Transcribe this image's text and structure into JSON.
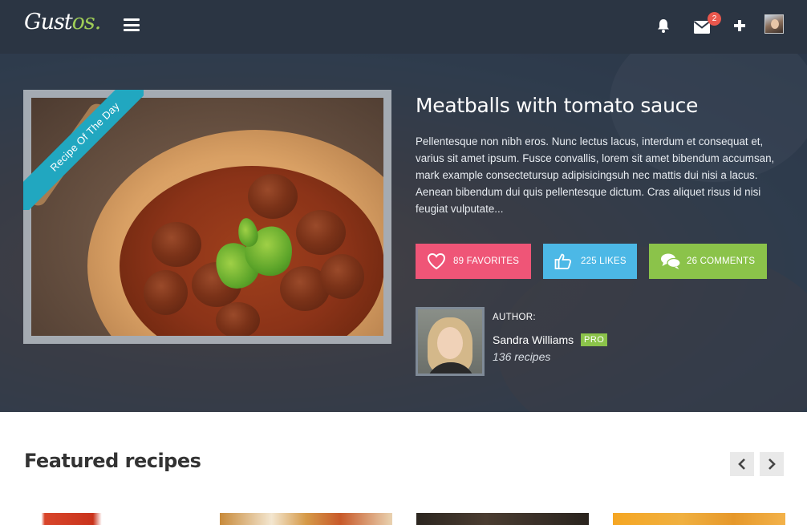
{
  "brand": {
    "name_main": "Gust",
    "name_accent": "os."
  },
  "header": {
    "menu_icon": "hamburger-icon",
    "notification_icon": "bell-icon",
    "messages_icon": "envelope-icon",
    "messages_count": "2",
    "add_icon": "plus-icon"
  },
  "hero": {
    "ribbon": "Recipe Of The Day",
    "title": "Meatballs with tomato sauce",
    "description": "Pellentesque non nibh eros. Nunc lectus lacus, interdum et consequat et, varius sit amet ipsum. Fusce convallis, lorem sit amet bibendum accumsan, mark example consectetursup adipisicingsuh nec mattis dui nisi a lacus. Aenean bibendum dui quis pellentesque dictum. Cras aliquet risus id nisi feugiat vulputate...",
    "actions": {
      "favorites": {
        "label": "89 FAVORITES",
        "icon": "heart-icon",
        "color": "#ef5577"
      },
      "likes": {
        "label": "225 LIKES",
        "icon": "thumbs-up-icon",
        "color": "#4cb8e6"
      },
      "comments": {
        "label": "26 COMMENTS",
        "icon": "comments-icon",
        "color": "#8bc34a"
      }
    },
    "author": {
      "label": "AUTHOR:",
      "name": "Sandra Williams",
      "badge": "PRO",
      "recipes": "136 recipes"
    }
  },
  "featured": {
    "title": "Featured recipes",
    "prev_icon": "chevron-left-icon",
    "next_icon": "chevron-right-icon"
  }
}
